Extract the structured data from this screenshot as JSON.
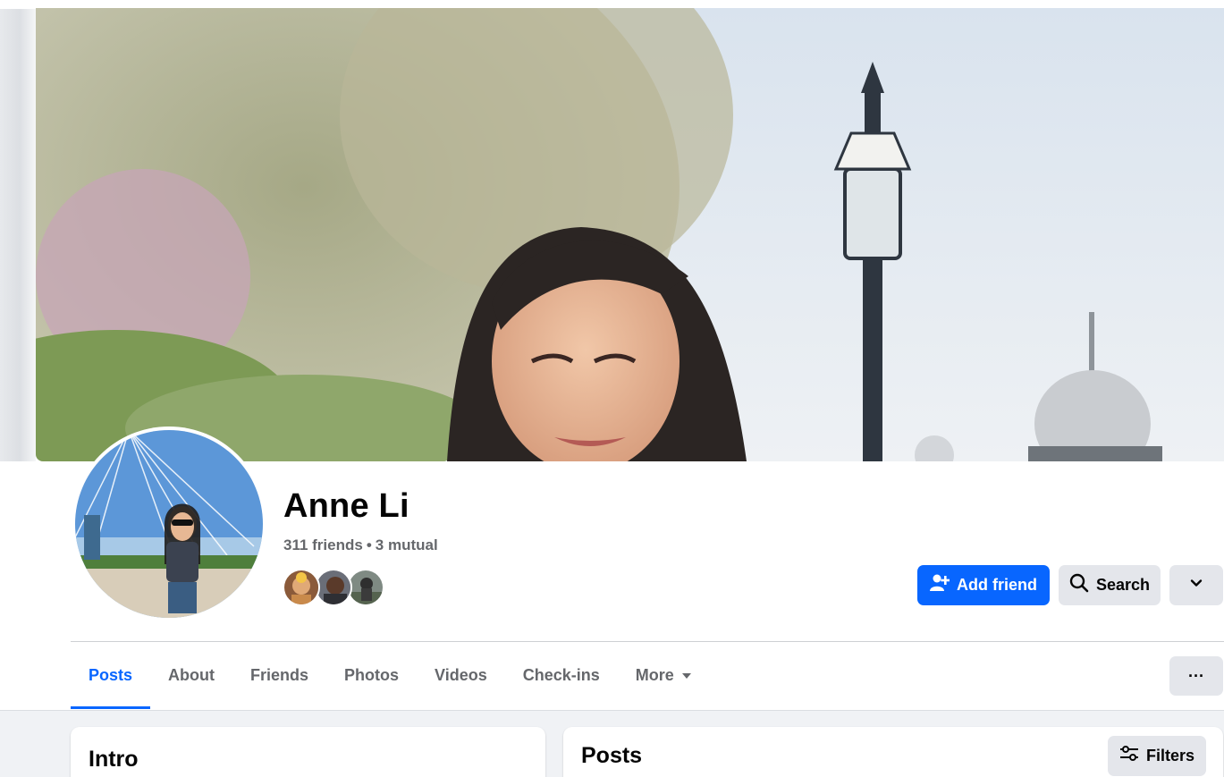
{
  "profile": {
    "name": "Anne Li",
    "friends_count": "311 friends",
    "separator": "•",
    "mutual_count": "3 mutual"
  },
  "actions": {
    "add_friend_label": "Add friend",
    "search_label": "Search"
  },
  "tabs": [
    {
      "label": "Posts",
      "active": true
    },
    {
      "label": "About",
      "active": false
    },
    {
      "label": "Friends",
      "active": false
    },
    {
      "label": "Photos",
      "active": false
    },
    {
      "label": "Videos",
      "active": false
    },
    {
      "label": "Check-ins",
      "active": false
    },
    {
      "label": "More",
      "active": false
    }
  ],
  "dots_label": "···",
  "intro": {
    "title": "Intro"
  },
  "posts": {
    "title": "Posts",
    "filters_label": "Filters"
  },
  "icons": {
    "add_friend": "add-person-icon",
    "search": "magnifier-icon",
    "more": "chevron-down-icon",
    "tab_more": "caret-down-icon",
    "filters": "sliders-icon"
  },
  "colors": {
    "accent": "#0866ff",
    "button_gray": "#e4e6eb",
    "secondary_text": "#65676b",
    "page_bg": "#f0f2f5"
  }
}
